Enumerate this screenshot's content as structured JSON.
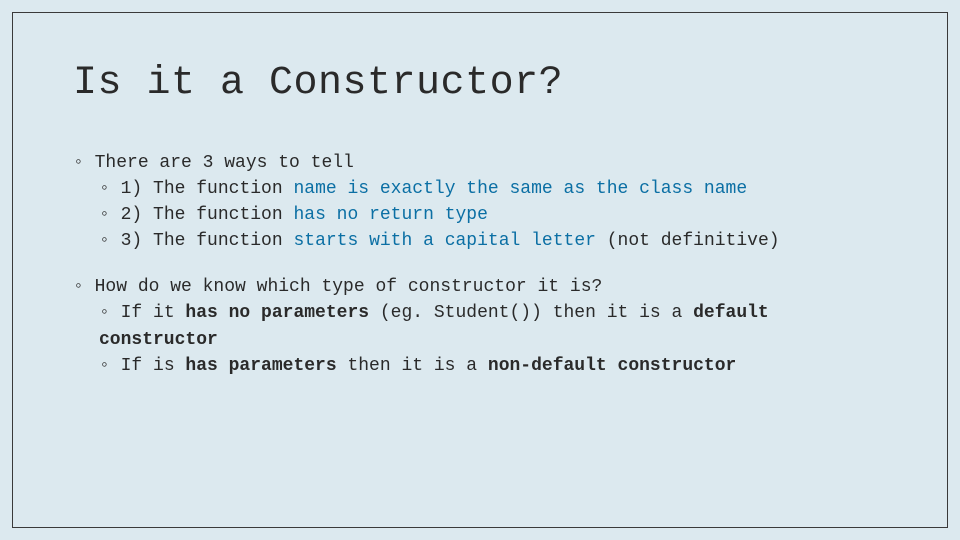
{
  "title": "Is it a Constructor?",
  "section1": {
    "lead": "There are 3 ways to tell",
    "items": [
      {
        "n": "1)",
        "pre": "The function ",
        "blue": "name is exactly the same as the class name",
        "post": ""
      },
      {
        "n": "2)",
        "pre": "The function ",
        "blue": "has no return type",
        "post": ""
      },
      {
        "n": "3)",
        "pre": "The function ",
        "blue": "starts with a capital letter",
        "post": " (not definitive)"
      }
    ]
  },
  "section2": {
    "lead": "How do we know which type of constructor it is?",
    "items": [
      {
        "a": "If it ",
        "b1": "has no parameters",
        "c": " (eg. Student()) then it is a ",
        "b2": "default constructor"
      },
      {
        "a": "If is ",
        "b1": "has parameters",
        "c": " then it is a ",
        "b2": "non-default constructor"
      }
    ]
  }
}
